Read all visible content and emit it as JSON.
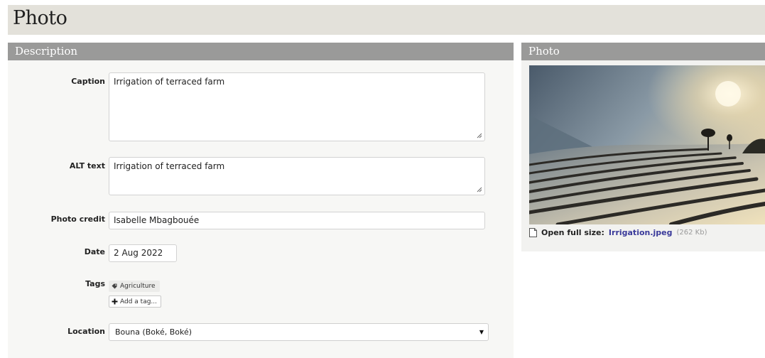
{
  "page": {
    "title": "Photo"
  },
  "description_panel": {
    "heading": "Description",
    "caption": {
      "label": "Caption",
      "value": "Irrigation of terraced farm"
    },
    "alt_text": {
      "label": "ALT text",
      "value": "Irrigation of terraced farm"
    },
    "photo_credit": {
      "label": "Photo credit",
      "value": "Isabelle Mbagbouée"
    },
    "date": {
      "label": "Date",
      "value": "2 Aug 2022"
    },
    "tags": {
      "label": "Tags",
      "items": [
        "Agriculture"
      ],
      "add_label": "Add a tag..."
    },
    "location": {
      "label": "Location",
      "value": "Bouna (Boké, Boké)"
    }
  },
  "photo_panel": {
    "heading": "Photo",
    "open_label": "Open full size:",
    "file_name": "Irrigation.jpeg",
    "file_size": "(262 Kb)"
  },
  "icons": {
    "tag": "tag-icon",
    "plus": "plus-icon",
    "file": "file-icon",
    "caret": "caret-down-icon",
    "resize": "resize-grip-icon"
  },
  "colors": {
    "header_bg": "#e3e1da",
    "panel_head_bg": "#9a9a99",
    "link": "#3a3a9a"
  }
}
